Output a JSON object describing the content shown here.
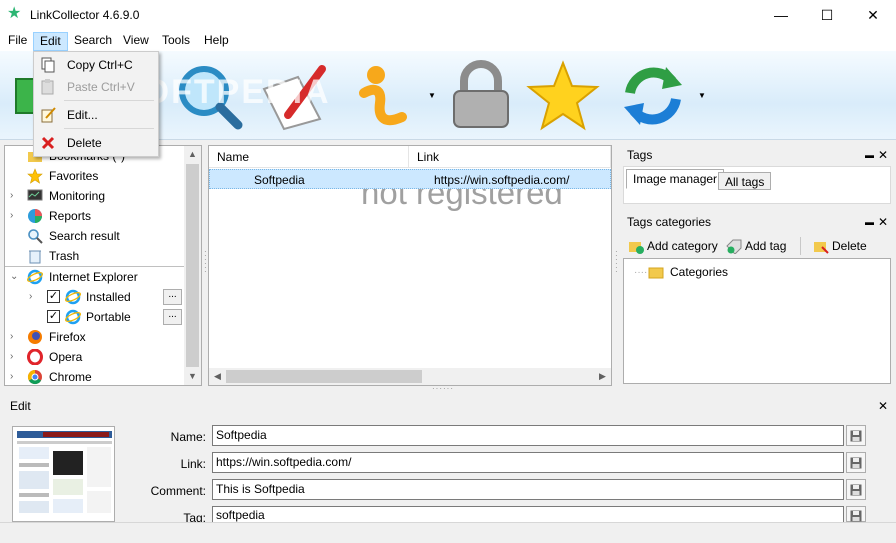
{
  "window": {
    "title": "LinkCollector 4.6.9.0",
    "min_glyph": "—",
    "max_glyph": "☐",
    "close_glyph": "✕"
  },
  "menu": [
    "File",
    "Edit",
    "Search",
    "View",
    "Tools",
    "Help"
  ],
  "edit_menu": {
    "copy": "Copy Ctrl+C",
    "paste": "Paste Ctrl+V",
    "edit": "Edit...",
    "delete": "Delete"
  },
  "toolbar": {
    "watermark": "SOFTPEDIA"
  },
  "tree": {
    "bookmarks": "Bookmarks (*)",
    "favorites": "Favorites",
    "monitoring": "Monitoring",
    "reports": "Reports",
    "search_result": "Search result",
    "trash": "Trash",
    "internet_explorer": "Internet Explorer",
    "installed": "Installed",
    "portable": "Portable",
    "firefox": "Firefox",
    "opera": "Opera",
    "chrome": "Chrome",
    "more_glyph": "...",
    "check_glyph": "✓"
  },
  "list": {
    "col_name": "Name",
    "col_link": "Link",
    "row_name": "Softpedia",
    "row_link": "https://win.softpedia.com/",
    "watermark": "not registered"
  },
  "tags": {
    "title": "Tags",
    "tab_image_manager": "Image manager",
    "tab_all_tags": "All tags"
  },
  "tag_categories": {
    "title": "Tags categories",
    "add_category": "Add category",
    "add_tag": "Add tag",
    "delete": "Delete",
    "root": "Categories"
  },
  "edit": {
    "title": "Edit",
    "name_label": "Name:",
    "name_value": "Softpedia",
    "link_label": "Link:",
    "link_value": "https://win.softpedia.com/",
    "comment_label": "Comment:",
    "comment_value": "This is Softpedia",
    "tag_label": "Tag:",
    "tag_value": "softpedia"
  },
  "colors": {
    "selection": "#cce8ff",
    "menu_active": "#cce8ff",
    "accent": "#0078d7"
  }
}
